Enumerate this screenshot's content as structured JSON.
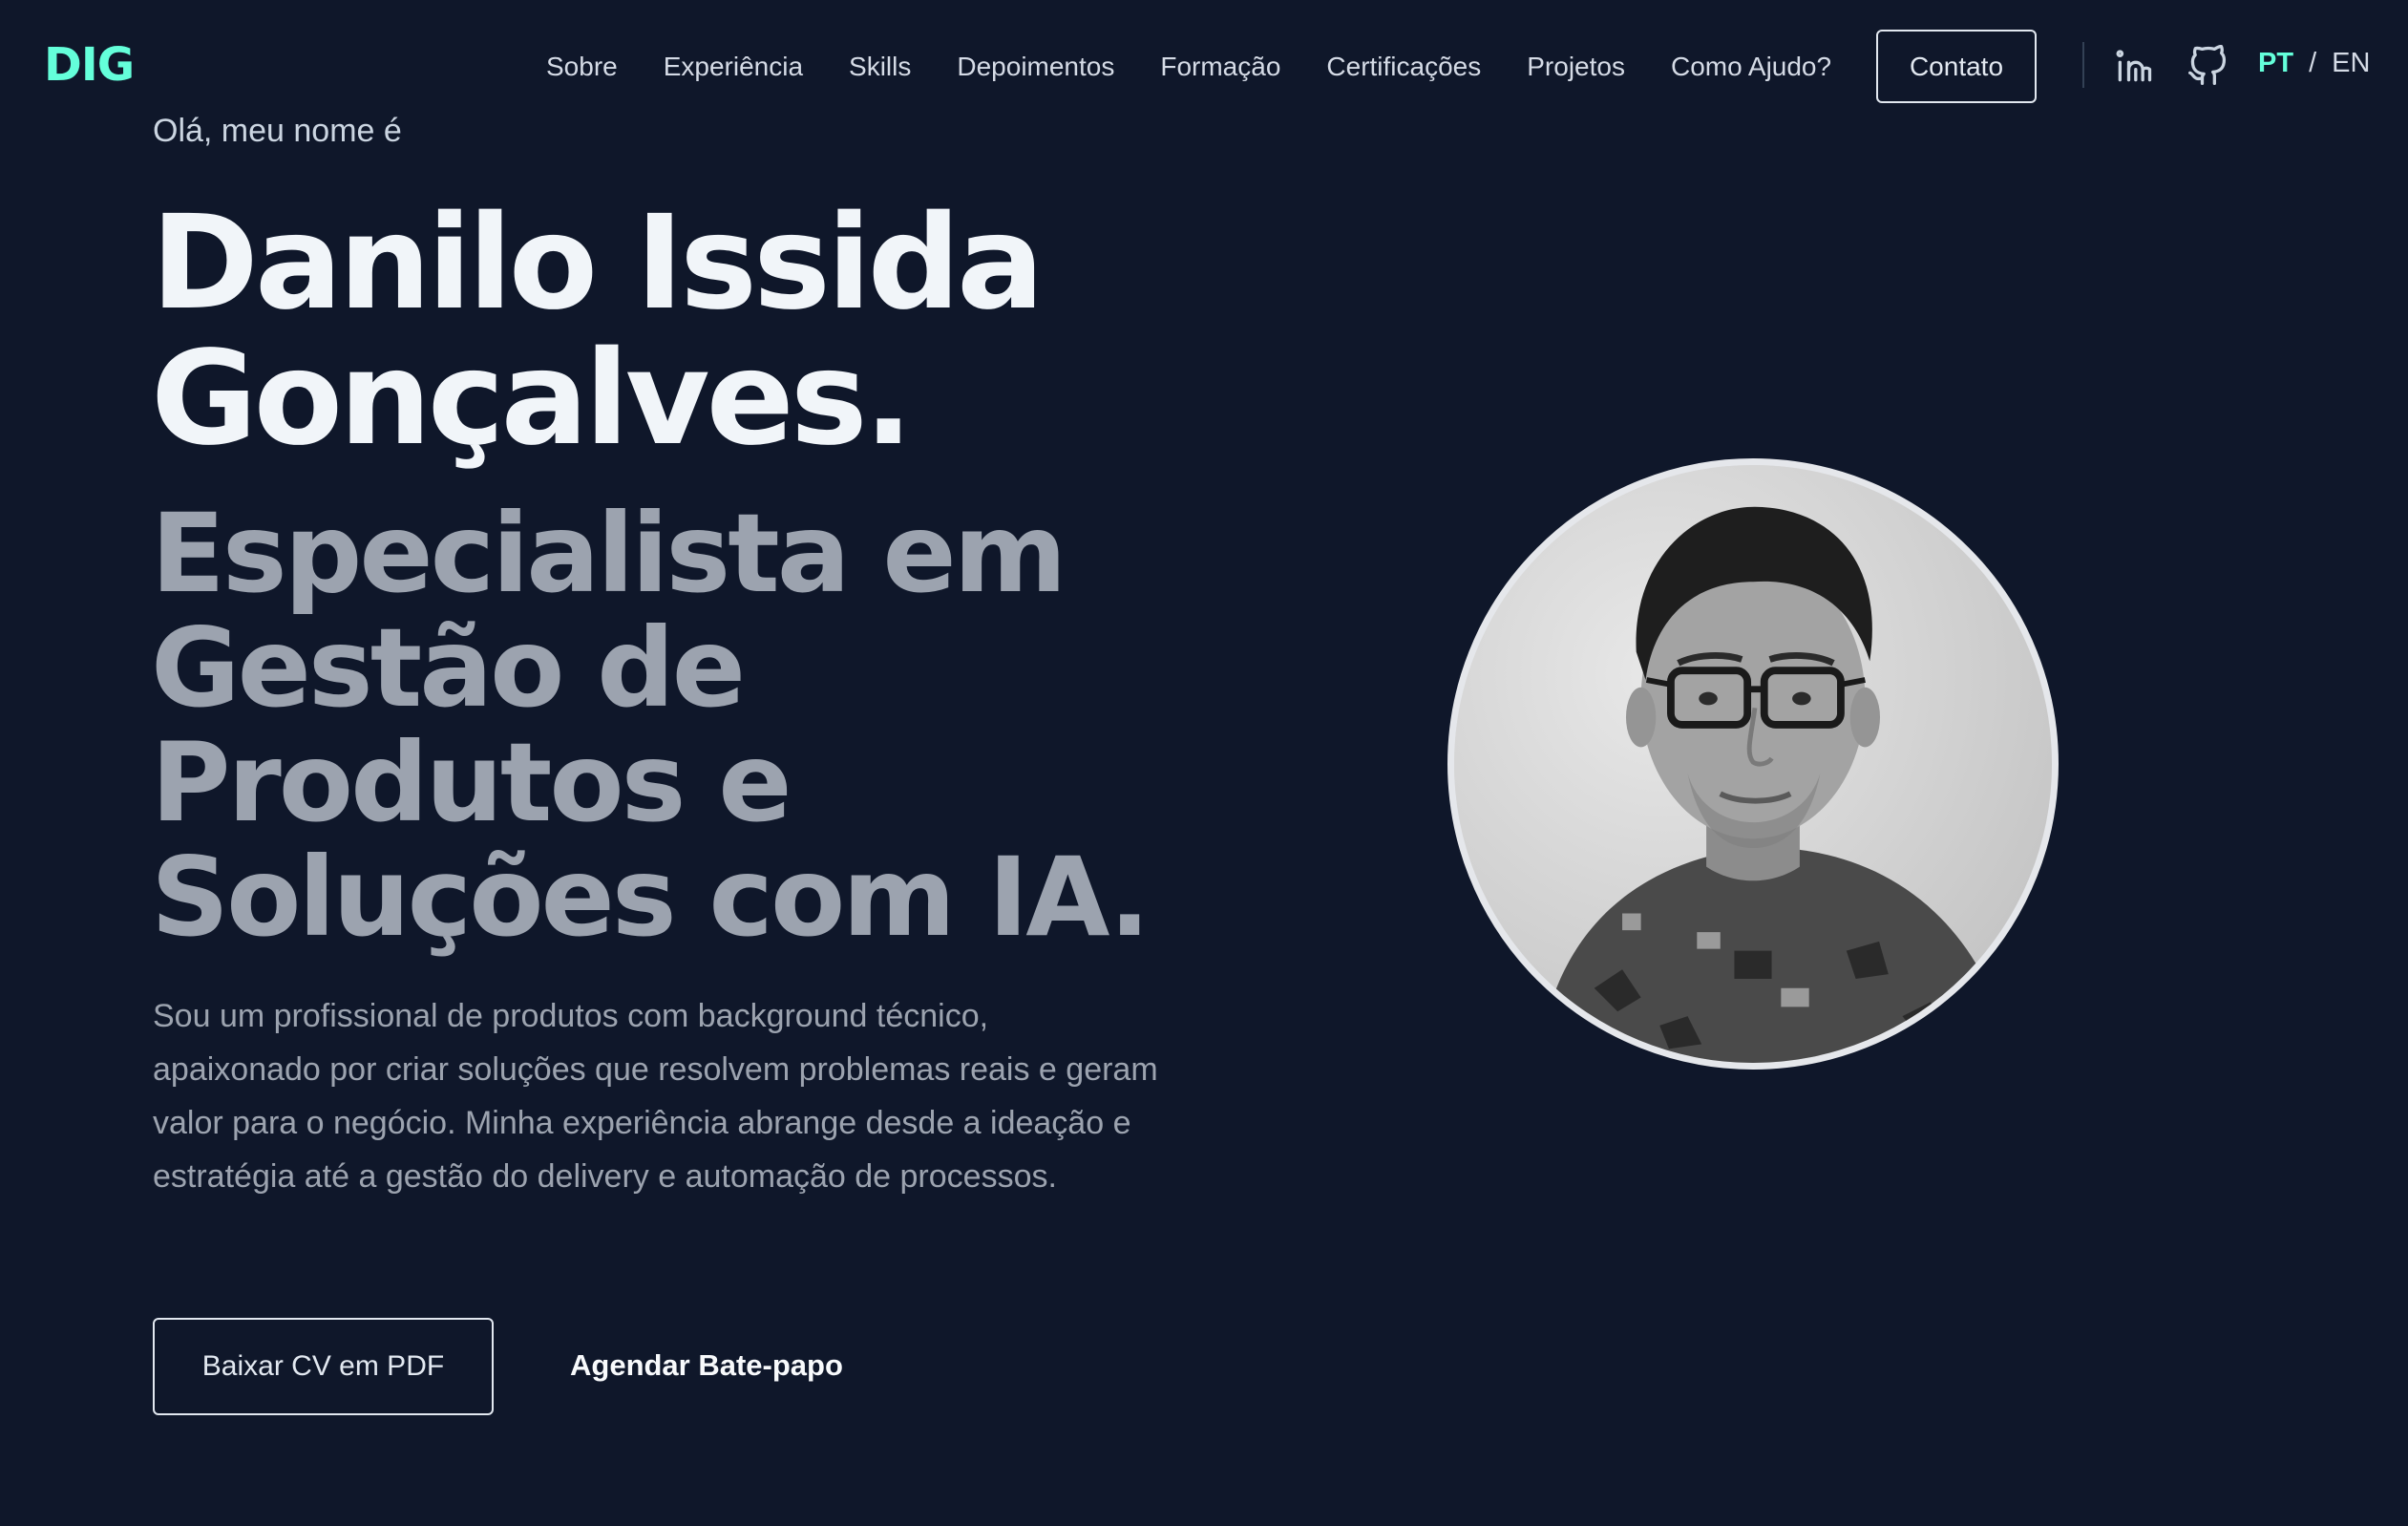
{
  "header": {
    "logo": "DIG",
    "nav": [
      {
        "label": "Sobre"
      },
      {
        "label": "Experiência"
      },
      {
        "label": "Skills"
      },
      {
        "label": "Depoimentos"
      },
      {
        "label": "Formação"
      },
      {
        "label": "Certificações"
      },
      {
        "label": "Projetos"
      },
      {
        "label": "Como Ajudo?"
      }
    ],
    "contact_label": "Contato",
    "icons": [
      "linkedin-icon",
      "github-icon"
    ],
    "lang": {
      "active": "PT",
      "separator": "/",
      "other": "EN"
    }
  },
  "hero": {
    "greeting": "Olá, meu nome é",
    "name_line1": "Danilo Issida",
    "name_line2": "Gonçalves.",
    "role_line1": "Especialista em",
    "role_line2": "Gestão de",
    "role_line3": "Produtos e",
    "role_line4": "Soluções com IA.",
    "bio": "Sou um profissional de produtos com background técnico, apaixonado por criar soluções que resolvem problemas reais e geram valor para o negócio. Minha experiência abrange desde a ideação e estratégia até a gestão do delivery e automação de processos.",
    "cv_button": "Baixar CV em PDF",
    "chat_link": "Agendar Bate-papo"
  },
  "colors": {
    "background": "#0f172a",
    "accent": "#64ffda",
    "heading": "#f1f5f9",
    "muted": "#9ca3af"
  }
}
